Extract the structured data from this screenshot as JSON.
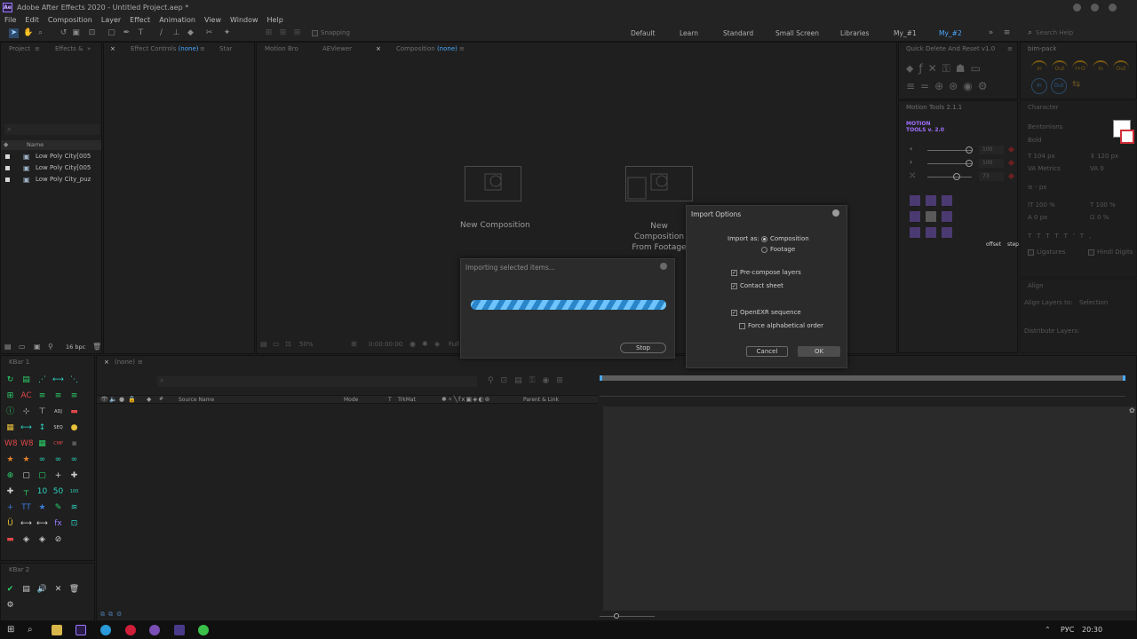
{
  "window": {
    "title": "Adobe After Effects 2020 - Untitled Project.aep *",
    "logo": "Ae"
  },
  "menu": [
    "File",
    "Edit",
    "Composition",
    "Layer",
    "Effect",
    "Animation",
    "View",
    "Window",
    "Help"
  ],
  "toolbar": {
    "snapping_label": "Snapping",
    "search_placeholder": "Search Help"
  },
  "workspaces": [
    {
      "label": "Default",
      "active": false
    },
    {
      "label": "Learn",
      "active": false
    },
    {
      "label": "Standard",
      "active": false
    },
    {
      "label": "Small Screen",
      "active": false
    },
    {
      "label": "Libraries",
      "active": false
    },
    {
      "label": "My_#1",
      "active": false
    },
    {
      "label": "My_#2",
      "active": true
    }
  ],
  "project_panel": {
    "tabs": [
      "Project",
      "Effects &"
    ],
    "column_name": "Name",
    "items": [
      "Low Poly City[005",
      "Low Poly City[005",
      "Low Poly City_puz"
    ],
    "bpc": "16 bpc"
  },
  "effect_controls": {
    "tab_label": "Effect Controls",
    "tab_value": "(none)",
    "extra_tab": "Star"
  },
  "viewer": {
    "tabs": [
      "Motion Bro",
      "AEViewer"
    ],
    "comp_tab_label": "Composition",
    "comp_tab_value": "(none)",
    "new_comp_label": "New Composition",
    "new_comp_footage_line1": "New Composition",
    "new_comp_footage_line2": "From Footage",
    "zoom": "50%",
    "timecode": "0:00:00:00",
    "resolution": "Full"
  },
  "progress_dialog": {
    "title": "Importing selected items...",
    "stop_label": "Stop",
    "progress": 1.0
  },
  "import_dialog": {
    "title": "Import Options",
    "import_as_label": "Import as:",
    "options": [
      {
        "label": "Composition",
        "selected": true
      },
      {
        "label": "Footage",
        "selected": false
      }
    ],
    "checks": [
      {
        "label": "Pre-compose layers",
        "checked": true
      },
      {
        "label": "Contact sheet",
        "checked": true
      },
      {
        "label": "OpenEXR sequence",
        "checked": true
      },
      {
        "label": "Force alphabetical order",
        "checked": false
      }
    ],
    "cancel_label": "Cancel",
    "ok_label": "OK"
  },
  "right_panels": {
    "quick_delete_title": "Quick Delete And Reset v1.0",
    "bim_pack_title": "bim-pack",
    "bim_labels": [
      "In",
      "Out",
      "I+O",
      "In",
      "Out"
    ],
    "motion_tools_title": "Motion Tools 2.1.1",
    "motion_tools_logo_line1": "MOTION",
    "motion_tools_logo_line2": "TOOLS v. 2.0",
    "mt_values": [
      "100",
      "100",
      "73"
    ],
    "mt_offset": "offset",
    "mt_step": "step",
    "character_title": "Character",
    "font_name": "Bentonians",
    "font_style": "Bold",
    "font_size": "104 px",
    "leading": "120 px",
    "kerning": "Metrics",
    "tracking": "0",
    "stroke_width": "- px",
    "vscale": "100 %",
    "hscale": "100 %",
    "baseline": "0 px",
    "tsume": "0 %",
    "ligatures": "Ligatures",
    "hindi_digits": "Hindi Digits",
    "align_title": "Align",
    "align_to_label": "Align Layers to:",
    "align_to_value": "Selection",
    "distribute_label": "Distribute Layers:"
  },
  "kbar": {
    "title1": "KBar 1",
    "title2": "KBar 2"
  },
  "timeline": {
    "tab_value": "(none)",
    "columns": [
      "Source Name",
      "Mode",
      "T",
      "TrkMat",
      "Parent & Link"
    ]
  },
  "taskbar": {
    "lang": "РУС",
    "time": "20:30"
  }
}
